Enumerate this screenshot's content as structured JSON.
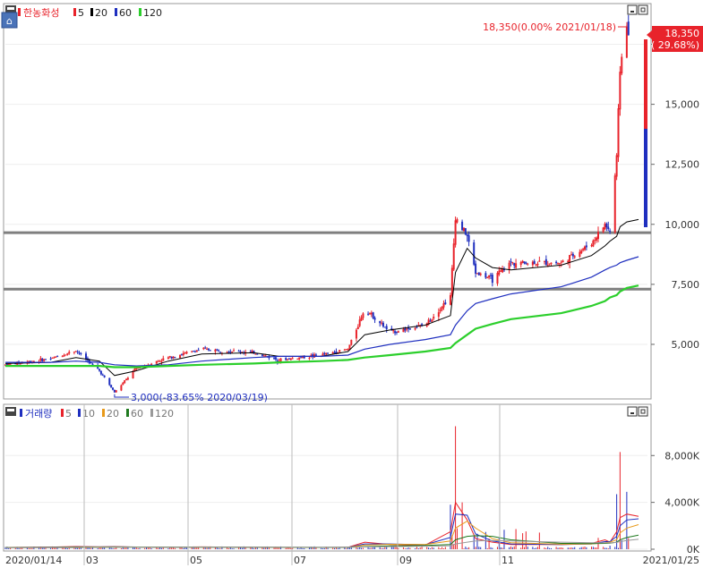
{
  "price_panel": {
    "legend": {
      "stock_name": "한농화성",
      "ma_labels": [
        "5",
        "20",
        "60",
        "120"
      ],
      "ma_colors": [
        "#e8232b",
        "#000000",
        "#1f2fbf",
        "#2ccf2c"
      ]
    },
    "y_ticks": [
      "5,000",
      "7,500",
      "10,000",
      "12,500",
      "15,000",
      "17,500"
    ],
    "current_price_label": "18,350",
    "current_change_label": "( 29.68%)",
    "high_annotation": "18,350(0.00% 2021/01/18)",
    "low_annotation": "3,000(-83.65% 2020/03/19)"
  },
  "volume_panel": {
    "legend": {
      "name": "거래량",
      "ma_labels": [
        "5",
        "10",
        "20",
        "60",
        "120"
      ],
      "ma_colors": [
        "#e8232b",
        "#1f2fbf",
        "#e89a1a",
        "#1f7a1f",
        "#9a9a9a"
      ]
    },
    "y_ticks": [
      "0K",
      "4,000K",
      "8,000K"
    ]
  },
  "x_axis": {
    "labels": [
      "2020/01/14",
      "03",
      "05",
      "07",
      "09",
      "11",
      "2021/01/25"
    ]
  },
  "colors": {
    "up": "#e8232b",
    "down": "#1f2fbf",
    "support_line": "#7f7f7f",
    "price_box": "#e8232b"
  },
  "chart_data": [
    {
      "type": "candlestick",
      "title": "한농화성",
      "x_range": [
        "2020/01/14",
        "2021/01/25"
      ],
      "y_range": [
        2800,
        18600
      ],
      "horizontal_levels": [
        9650,
        7300
      ],
      "price_path_approx": [
        [
          "2020/01/14",
          4150
        ],
        [
          "2020/02/10",
          4400
        ],
        [
          "2020/02/25",
          4750
        ],
        [
          "2020/03/10",
          3900
        ],
        [
          "2020/03/19",
          3000
        ],
        [
          "2020/04/01",
          4000
        ],
        [
          "2020/04/20",
          4450
        ],
        [
          "2020/05/10",
          4800
        ],
        [
          "2020/06/10",
          4650
        ],
        [
          "2020/06/25",
          4350
        ],
        [
          "2020/07/20",
          4550
        ],
        [
          "2020/08/05",
          4800
        ],
        [
          "2020/08/15",
          6500
        ],
        [
          "2020/08/30",
          5500
        ],
        [
          "2020/09/20",
          5800
        ],
        [
          "2020/10/05",
          7000
        ],
        [
          "2020/10/08",
          10300
        ],
        [
          "2020/10/15",
          9500
        ],
        [
          "2020/10/20",
          8000
        ],
        [
          "2020/10/30",
          7700
        ],
        [
          "2020/11/10",
          8400
        ],
        [
          "2020/12/10",
          8400
        ],
        [
          "2020/12/28",
          9200
        ],
        [
          "2021/01/05",
          10000
        ],
        [
          "2021/01/08",
          9700
        ],
        [
          "2021/01/12",
          12800
        ],
        [
          "2021/01/14",
          16500
        ],
        [
          "2021/01/18",
          18350
        ],
        [
          "2021/01/25",
          14000
        ]
      ],
      "high": {
        "date": "2021/01/18",
        "value": 18350
      },
      "low": {
        "date": "2020/03/19",
        "value": 3000
      },
      "series": [
        {
          "name": "5",
          "values": [
            4150,
            4400,
            4650,
            3950,
            3200,
            3900,
            4400,
            4750,
            4650,
            4400,
            4550,
            4800,
            6200,
            5600,
            5800,
            6800,
            9600,
            9300,
            8200,
            7800,
            8300,
            8400,
            9100,
            9900,
            9800,
            12000,
            15000,
            17000,
            18000
          ]
        },
        {
          "name": "20",
          "values": [
            4200,
            4250,
            4450,
            4300,
            3700,
            3900,
            4300,
            4600,
            4650,
            4500,
            4500,
            4700,
            5400,
            5600,
            5800,
            6200,
            8000,
            9000,
            8600,
            8200,
            8100,
            8300,
            8700,
            9100,
            9300,
            9500,
            9900,
            10100,
            10200
          ]
        },
        {
          "name": "60",
          "values": [
            4250,
            4250,
            4300,
            4250,
            4150,
            4100,
            4150,
            4300,
            4450,
            4500,
            4500,
            4550,
            4800,
            5000,
            5200,
            5400,
            5800,
            6400,
            6700,
            6900,
            7100,
            7400,
            7800,
            8100,
            8200,
            8300,
            8400,
            8500,
            8650
          ]
        },
        {
          "name": "120",
          "values": [
            4100,
            4100,
            4100,
            4100,
            4050,
            4050,
            4100,
            4150,
            4200,
            4250,
            4300,
            4350,
            4450,
            4550,
            4700,
            4850,
            5050,
            5400,
            5650,
            5850,
            6050,
            6300,
            6600,
            6800,
            6950,
            7050,
            7200,
            7350,
            7450
          ]
        }
      ]
    },
    {
      "type": "bar",
      "title": "거래량",
      "y_range": [
        0,
        11000
      ],
      "unit": "K",
      "spikes": [
        {
          "date": "2020/02/25",
          "value": 250
        },
        {
          "date": "2020/05/10",
          "value": 250
        },
        {
          "date": "2020/08/15",
          "value": 900
        },
        {
          "date": "2020/10/05",
          "value": 3800
        },
        {
          "date": "2020/10/08",
          "value": 10500
        },
        {
          "date": "2020/10/12",
          "value": 4000
        },
        {
          "date": "2021/01/12",
          "value": 4700
        },
        {
          "date": "2021/01/14",
          "value": 8300
        },
        {
          "date": "2021/01/18",
          "value": 4900
        }
      ],
      "series": [
        {
          "name": "5",
          "values": [
            150,
            180,
            230,
            200,
            220,
            180,
            170,
            200,
            160,
            150,
            150,
            170,
            600,
            400,
            350,
            1500,
            4000,
            2500,
            900,
            600,
            400,
            400,
            500,
            800,
            600,
            1500,
            2700,
            3000,
            2800
          ]
        },
        {
          "name": "10",
          "values": [
            150,
            170,
            200,
            200,
            210,
            190,
            170,
            190,
            170,
            150,
            150,
            160,
            450,
            450,
            380,
            1000,
            3000,
            2900,
            1300,
            700,
            450,
            400,
            450,
            650,
            650,
            1100,
            2000,
            2500,
            2600
          ]
        },
        {
          "name": "20",
          "values": [
            150,
            160,
            180,
            190,
            200,
            190,
            180,
            180,
            170,
            160,
            150,
            160,
            350,
            420,
            400,
            700,
            1800,
            2400,
            1800,
            900,
            550,
            430,
            450,
            550,
            600,
            800,
            1400,
            1800,
            2100
          ]
        },
        {
          "name": "60",
          "values": [
            140,
            150,
            160,
            170,
            180,
            180,
            180,
            175,
            170,
            165,
            160,
            160,
            220,
            280,
            320,
            400,
            800,
            1100,
            1150,
            1100,
            800,
            500,
            480,
            500,
            520,
            600,
            800,
            1000,
            1200
          ]
        },
        {
          "name": "120",
          "values": [
            130,
            135,
            140,
            150,
            160,
            165,
            170,
            170,
            170,
            168,
            165,
            165,
            190,
            220,
            250,
            300,
            450,
            600,
            700,
            750,
            700,
            600,
            550,
            540,
            540,
            580,
            650,
            750,
            850
          ]
        }
      ]
    }
  ]
}
